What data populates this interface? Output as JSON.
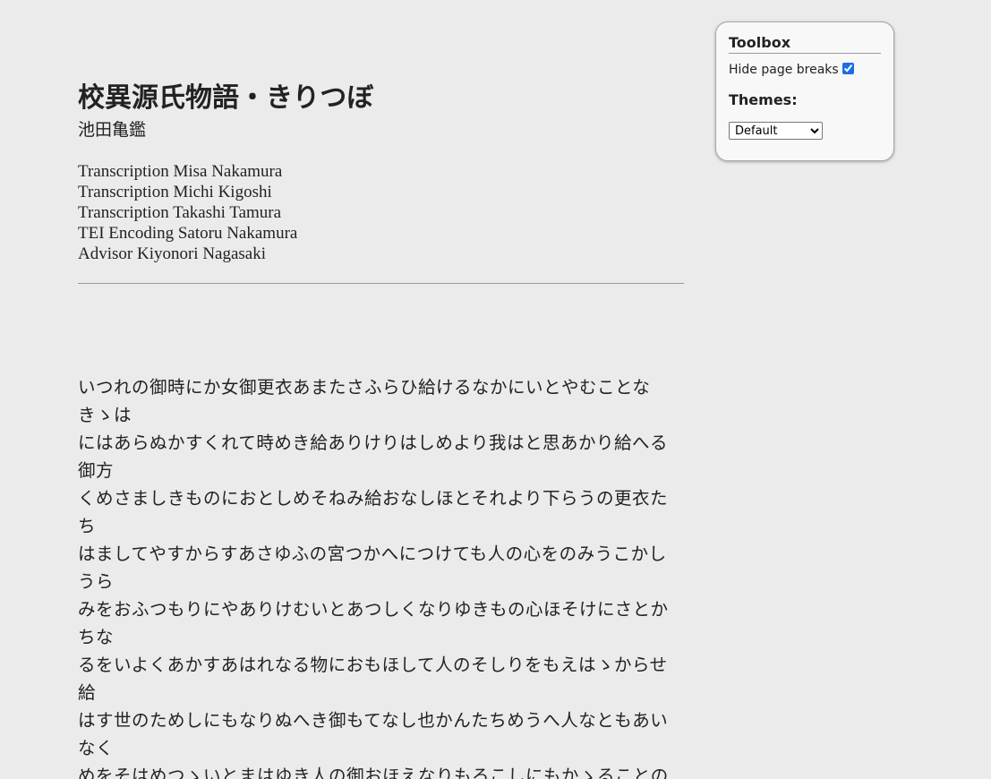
{
  "document": {
    "title": "校異源氏物語・きりつぼ",
    "subtitle": "池田亀鑑",
    "credits": [
      "Transcription Misa Nakamura",
      "Transcription Michi Kigoshi",
      "Transcription Takashi Tamura",
      "TEI Encoding Satoru Nakamura",
      "Advisor Kiyonori Nagasaki"
    ],
    "lines": [
      "いつれの御時にか女御更衣あまたさふらひ給けるなかにいとやむことなきゝは",
      "にはあらぬかすくれて時めき給ありけりはしめより我はと思あかり給へる御方",
      "くめさましきものにおとしめそねみ給おなしほとそれより下らうの更衣たち",
      "はましてやすからすあさゆふの宮つかへにつけても人の心をのみうこかしうら",
      "みをおふつもりにやありけむいとあつしくなりゆきもの心ほそけにさとかちな",
      "るをいよくあかすあはれなる物におもほして人のそしりをもえはゝからせ給",
      "はす世のためしにもなりぬへき御もてなし也かんたちめうへ人なともあいなく",
      "めをそはめつゝいとまはゆき人の御おほえなりもろこしにもかゝることの"
    ]
  },
  "toolbox": {
    "title": "Toolbox",
    "hide_page_breaks_label": "Hide page breaks",
    "hide_page_breaks_checked": true,
    "themes_label": "Themes:",
    "theme_selected": "Default"
  }
}
